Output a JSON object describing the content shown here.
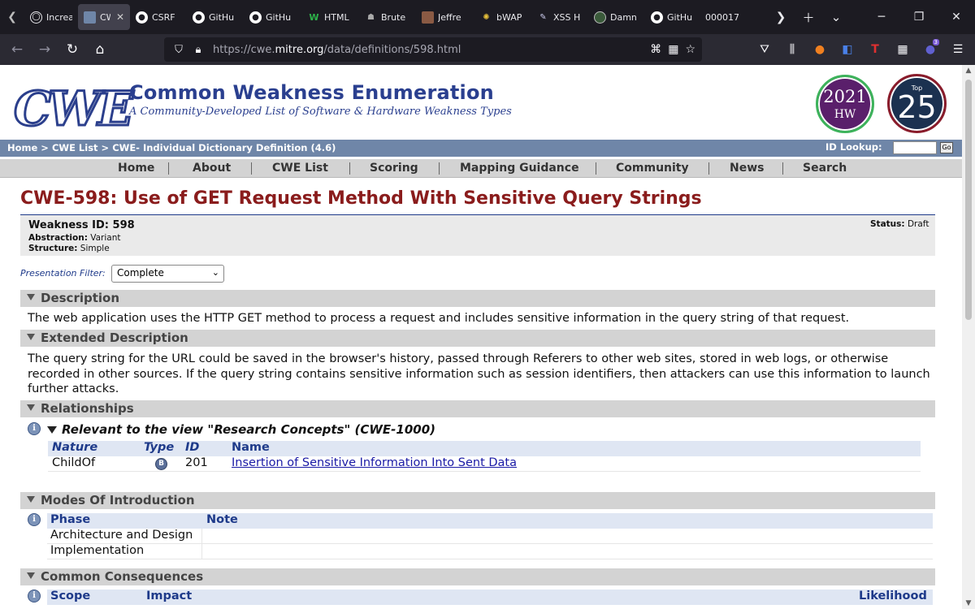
{
  "browser": {
    "tabs": [
      {
        "label": "Increa",
        "icon": "globe-icon",
        "active": false
      },
      {
        "label": "CW",
        "icon": "cwe-favicon",
        "active": true
      },
      {
        "label": "CSRF",
        "icon": "github-icon",
        "active": false
      },
      {
        "label": "GitHu",
        "icon": "github-icon",
        "active": false
      },
      {
        "label": "GitHu",
        "icon": "github-icon",
        "active": false
      },
      {
        "label": "HTML",
        "icon": "w3-icon",
        "active": false
      },
      {
        "label": "Brute",
        "icon": "hacker-icon",
        "active": false
      },
      {
        "label": "Jeffre",
        "icon": "person-icon",
        "active": false
      },
      {
        "label": "bWAP",
        "icon": "bee-icon",
        "active": false
      },
      {
        "label": "XSS H",
        "icon": "pencil-icon",
        "active": false
      },
      {
        "label": "Damn",
        "icon": "dvwa-icon",
        "active": false
      },
      {
        "label": "GitHu",
        "icon": "github-icon",
        "active": false
      },
      {
        "label": "000017",
        "icon": "",
        "active": false
      }
    ],
    "url_prefix": "https://cwe.",
    "url_domain": "mitre.org",
    "url_path": "/data/definitions/598.html",
    "extension_badge": "3"
  },
  "site": {
    "logo_text": "CWE",
    "title": "Common Weakness Enumeration",
    "subtitle": "A Community-Developed List of Software & Hardware Weakness Types",
    "badge_hw_year": "2021",
    "badge_hw_label": "HW",
    "badge_top_label": "Top",
    "badge_top_num": "25"
  },
  "breadcrumb": {
    "text": "Home > CWE List > CWE- Individual Dictionary Definition (4.6)",
    "id_lookup_label": "ID Lookup:",
    "go_label": "Go"
  },
  "menu": [
    "Home",
    "About",
    "CWE List",
    "Scoring",
    "Mapping Guidance",
    "Community",
    "News",
    "Search"
  ],
  "page": {
    "title": "CWE-598: Use of GET Request Method With Sensitive Query Strings",
    "weakness_id": "Weakness ID: 598",
    "abstraction_label": "Abstraction:",
    "abstraction_value": "Variant",
    "structure_label": "Structure:",
    "structure_value": "Simple",
    "status_label": "Status:",
    "status_value": "Draft",
    "filter_label": "Presentation Filter:",
    "filter_value": "Complete"
  },
  "sections": {
    "description": {
      "title": "Description",
      "text": "The web application uses the HTTP GET method to process a request and includes sensitive information in the query string of that request."
    },
    "extended": {
      "title": "Extended Description",
      "text": "The query string for the URL could be saved in the browser's history, passed through Referers to other web sites, stored in web logs, or otherwise recorded in other sources. If the query string contains sensitive information such as session identifiers, then attackers can use this information to launch further attacks."
    },
    "relationships": {
      "title": "Relationships",
      "view_title": "Relevant to the view \"Research Concepts\" (CWE-1000)",
      "headers": [
        "Nature",
        "Type",
        "ID",
        "Name"
      ],
      "rows": [
        {
          "nature": "ChildOf",
          "type": "B",
          "id": "201",
          "name": "Insertion of Sensitive Information Into Sent Data"
        }
      ]
    },
    "modes": {
      "title": "Modes Of Introduction",
      "headers": [
        "Phase",
        "Note"
      ],
      "rows": [
        {
          "phase": "Architecture and Design",
          "note": ""
        },
        {
          "phase": "Implementation",
          "note": ""
        }
      ]
    },
    "consequences": {
      "title": "Common Consequences",
      "headers": [
        "Scope",
        "Impact",
        "Likelihood"
      ]
    }
  }
}
